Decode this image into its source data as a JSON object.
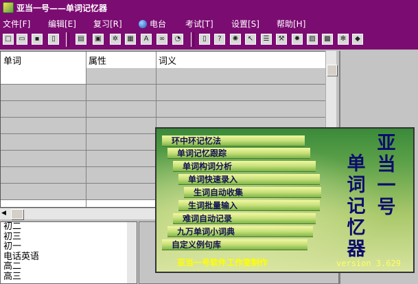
{
  "window": {
    "title": "亚当一号——单词记忆器"
  },
  "menu": [
    "文件[F]",
    "编辑[E]",
    "复习[R]",
    "电台",
    "考试[T]",
    "设置[S]",
    "帮助[H]"
  ],
  "grid": {
    "columns": [
      "单词",
      "属性",
      "词义"
    ]
  },
  "word_list": [
    "初二",
    "初三",
    "初一",
    "电话英语",
    "高二",
    "高三"
  ],
  "splash": {
    "title_col1": "亚当一号",
    "title_col2": "单词记忆器",
    "features": [
      "环中环记忆法",
      "单词记忆跟踪",
      "单词构词分析",
      "单词快速录入",
      "生词自动收集",
      "生词批量输入",
      "难词自动记录",
      "九万单词小词典",
      "自定义例句库"
    ],
    "footer": "亚当一号软件工作室制作",
    "version": "version 3.629"
  },
  "colors": {
    "titlebar": "#7b0c72",
    "splash_text": "#0c0c6c",
    "footer_text": "#ffff00"
  }
}
